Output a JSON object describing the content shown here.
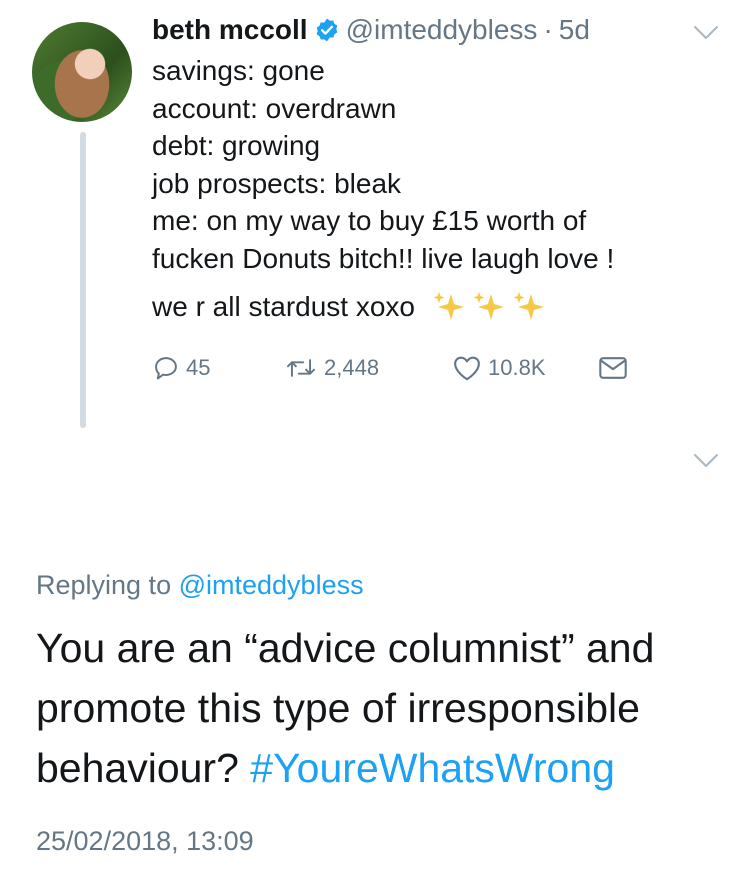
{
  "tweet": {
    "display_name": "beth mccoll",
    "handle": "@imteddybless",
    "separator": "·",
    "age": "5d",
    "lines": [
      "savings: gone",
      "account: overdrawn",
      "debt: growing",
      "job prospects: bleak",
      "me: on my way to buy £15 worth of",
      "fucken Donuts bitch!! live laugh love !"
    ],
    "last_line": "we r all stardust xoxo",
    "actions": {
      "replies": "45",
      "retweets": "2,448",
      "likes": "10.8K"
    }
  },
  "reply": {
    "replying_prefix": "Replying to",
    "replying_handle": "@imteddybless",
    "text": "You are an “advice columnist” and promote this type of irresponsible behaviour?",
    "hashtag": "#YoureWhatsWrong",
    "timestamp": "25/02/2018, 13:09"
  },
  "colors": {
    "text": "#14171a",
    "muted": "#657786",
    "accent": "#1da1f2",
    "thread_line": "#d3dbe2"
  },
  "icons": [
    "reply-icon",
    "retweet-icon",
    "like-icon",
    "direct-message-icon",
    "verified-badge-icon",
    "chevron-down-icon",
    "sparkles-icon"
  ]
}
